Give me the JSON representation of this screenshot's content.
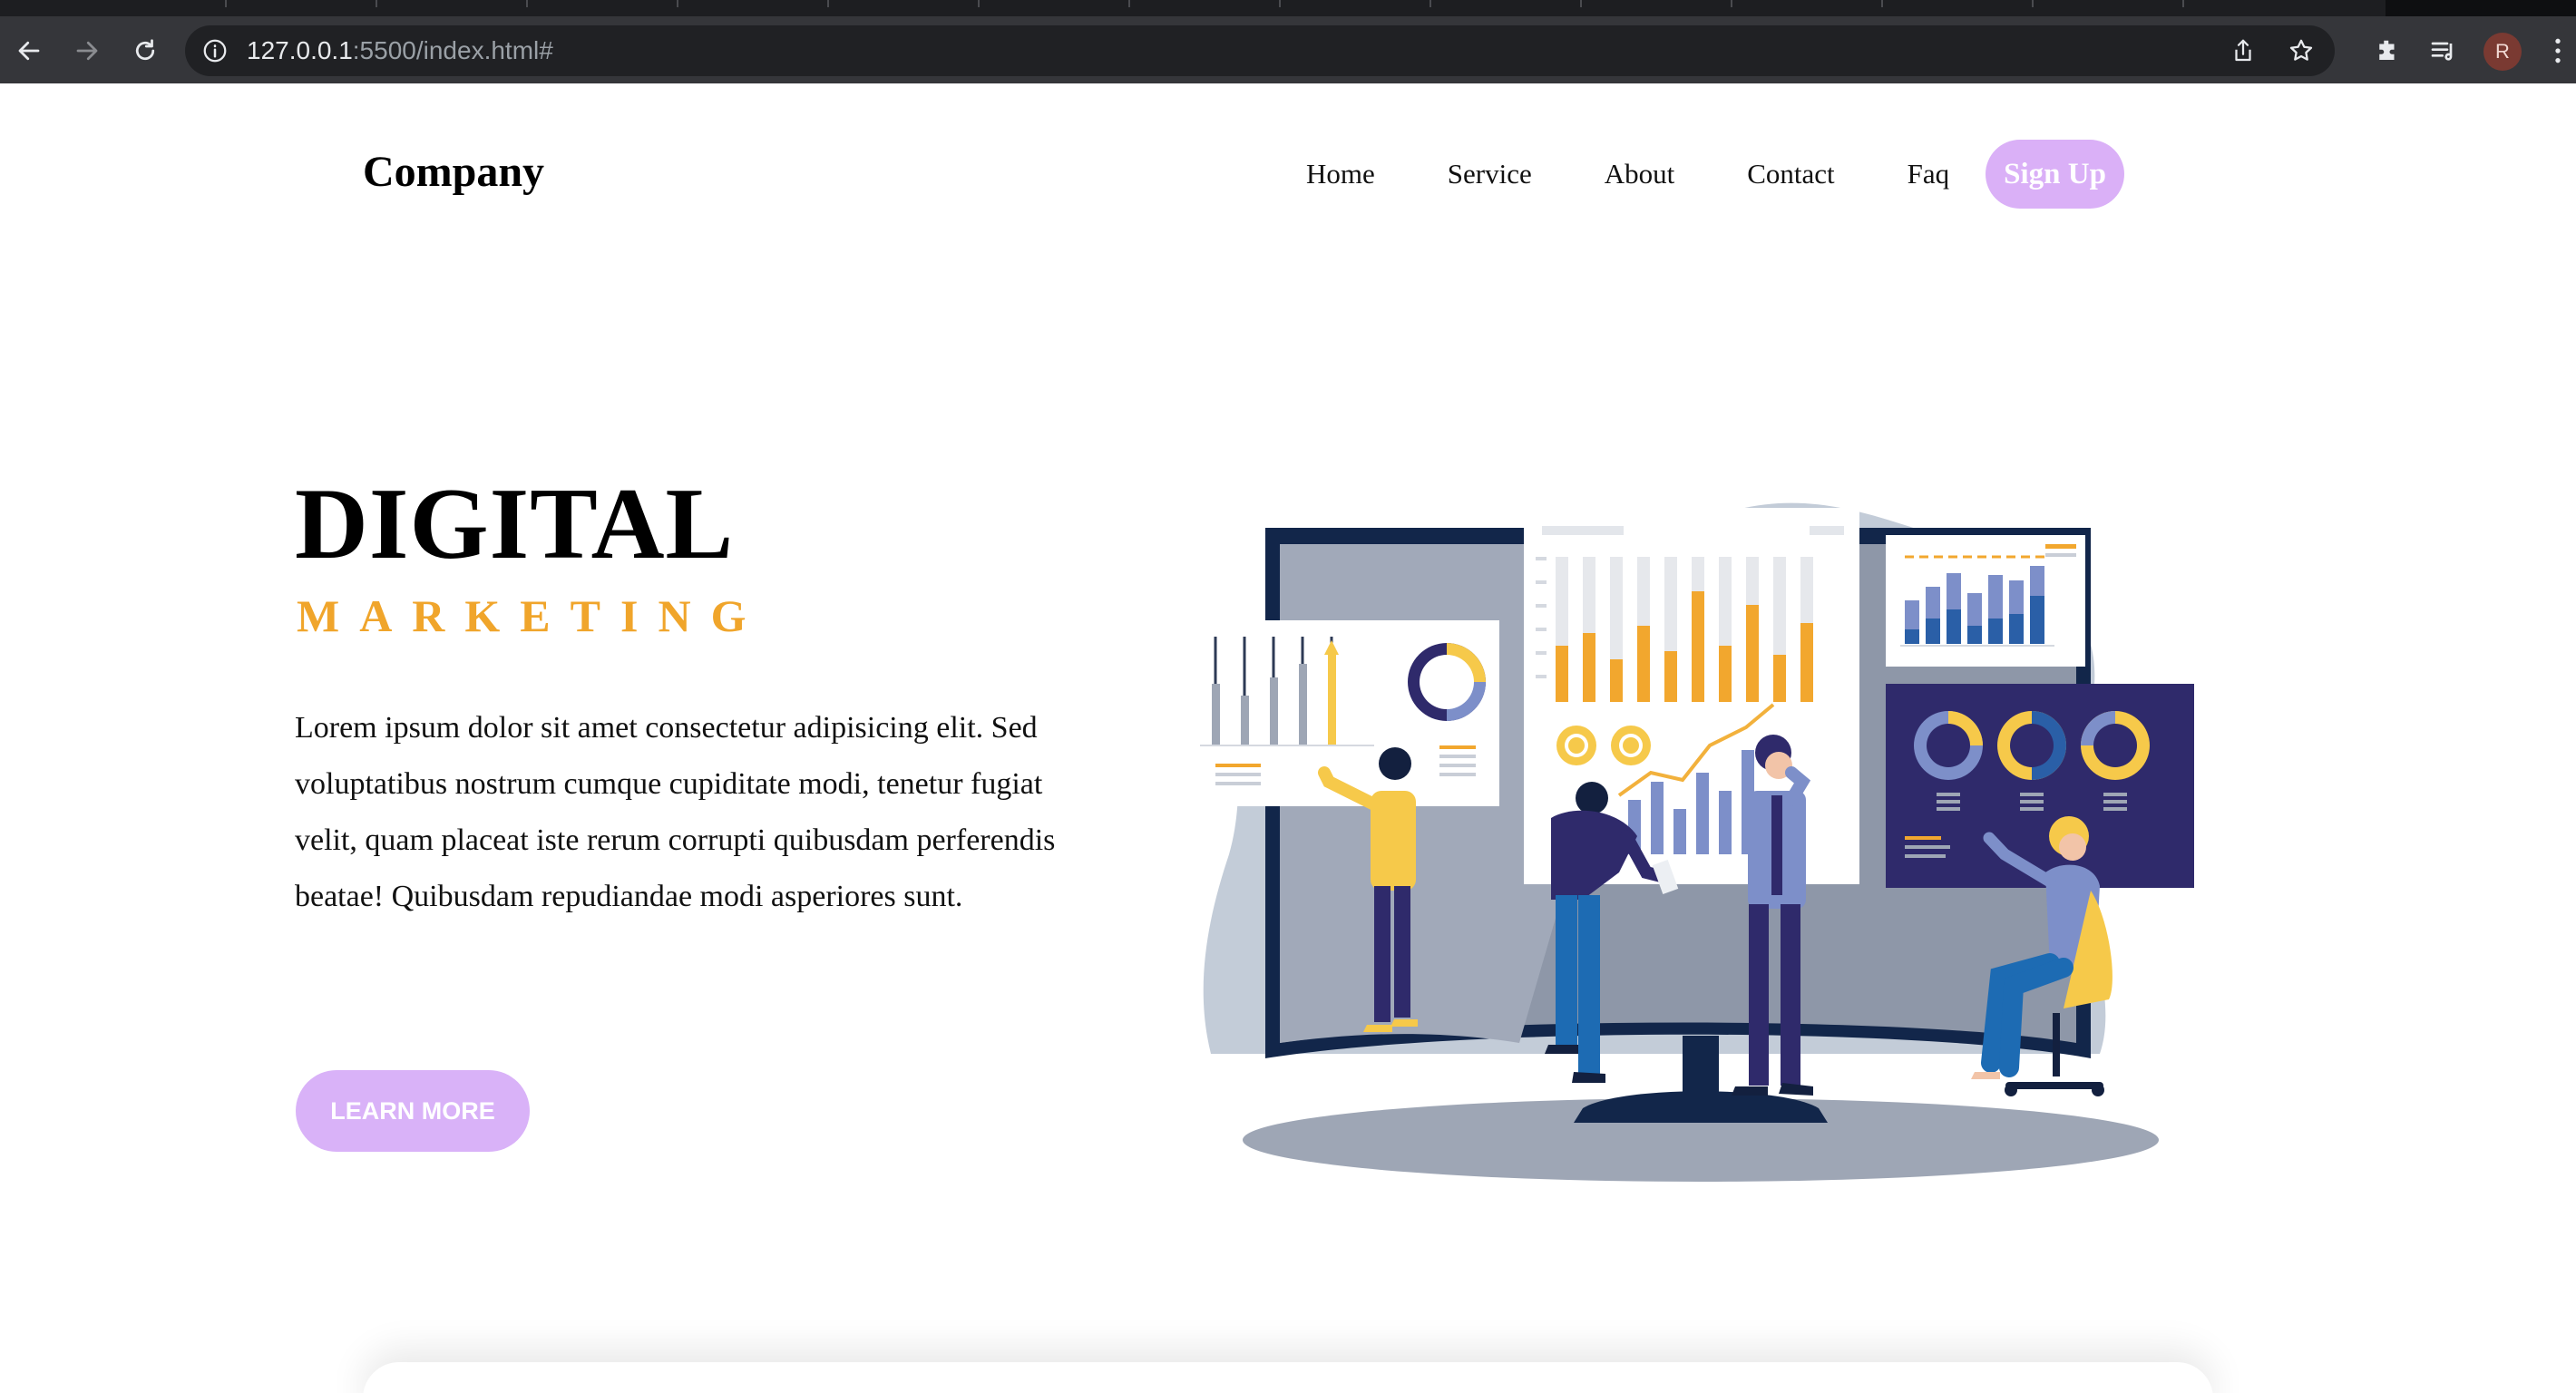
{
  "browser": {
    "url_host": "127.0.0.1",
    "url_rest": ":5500/index.html#",
    "profile_initial": "R"
  },
  "header": {
    "brand": "Company",
    "nav": [
      "Home",
      "Service",
      "About",
      "Contact",
      "Faq"
    ],
    "signup_label": "Sign Up"
  },
  "hero": {
    "title": "DIGITAL",
    "subtitle": "MARKETING",
    "text": "Lorem ipsum dolor sit amet consectetur adipisicing elit. Sed voluptatibus nostrum cumque cupiditate modi, tenetur fugiat velit, quam placeat iste rerum corrupti quibusdam perferendis beatae! Quibusdam repudiandae modi asperiores sunt.",
    "cta_label": "LEARN MORE"
  },
  "colors": {
    "accent_purple": "#d9b2f8",
    "accent_orange": "#f0a52b",
    "navy": "#2f2a6b"
  },
  "illustration": {
    "icon": "digital-marketing-team-illustration"
  }
}
